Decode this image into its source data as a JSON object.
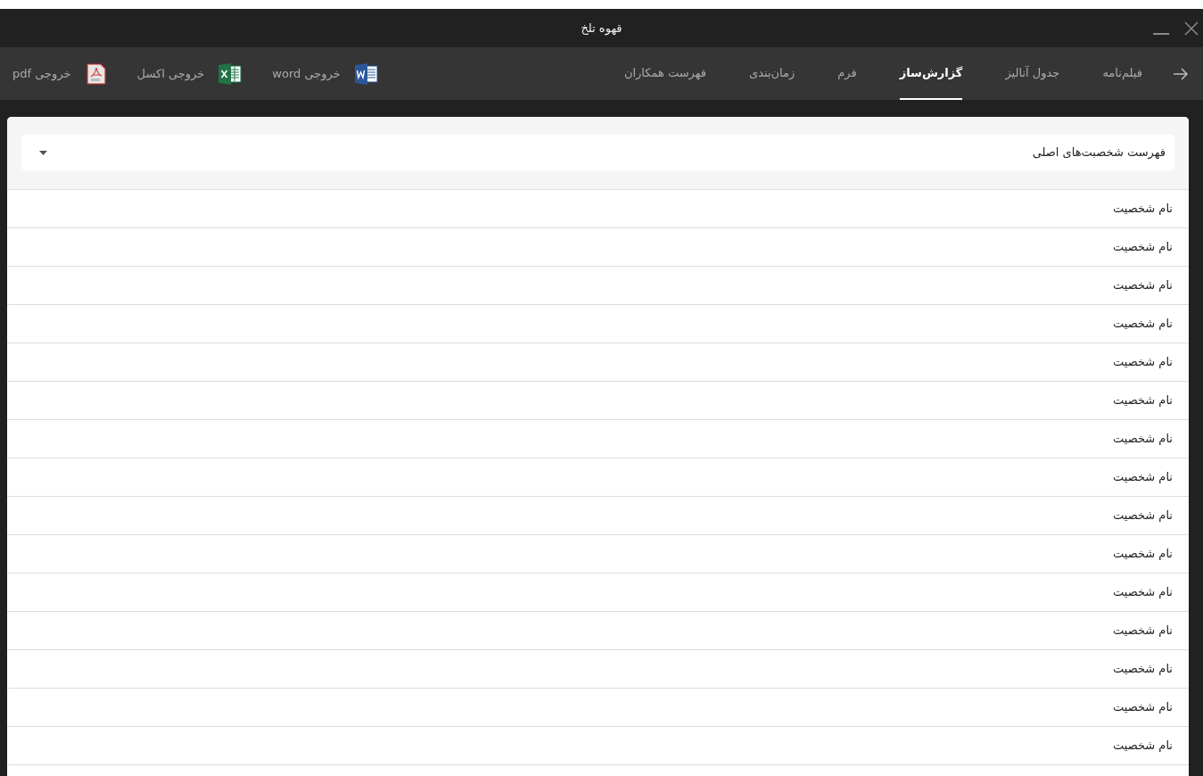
{
  "window": {
    "title": "قهوه تلخ"
  },
  "tabs": [
    {
      "label": "فیلم‌نامه",
      "selected": false
    },
    {
      "label": "جدول آنالیز",
      "selected": false
    },
    {
      "label": "گزارش‌ساز",
      "selected": true
    },
    {
      "label": "فرم",
      "selected": false
    },
    {
      "label": "زمان‌بندی",
      "selected": false
    },
    {
      "label": "فهرست همکاران",
      "selected": false
    }
  ],
  "exports": [
    {
      "kind": "word",
      "label": "خروجی word"
    },
    {
      "kind": "excel",
      "label": "خروجی اکسل"
    },
    {
      "kind": "pdf",
      "label": "خروجی pdf"
    }
  ],
  "dropdown": {
    "value": "فهرست شخصبت‌های اصلی"
  },
  "rows": [
    {
      "name": "نام شخصیت"
    },
    {
      "name": "نام شخصیت"
    },
    {
      "name": "نام شخصیت"
    },
    {
      "name": "نام شخصیت"
    },
    {
      "name": "نام شخصیت"
    },
    {
      "name": "نام شخصیت"
    },
    {
      "name": "نام شخصیت"
    },
    {
      "name": "نام شخصیت"
    },
    {
      "name": "نام شخصیت"
    },
    {
      "name": "نام شخصیت"
    },
    {
      "name": "نام شخصیت"
    },
    {
      "name": "نام شخصیت"
    },
    {
      "name": "نام شخصیت"
    },
    {
      "name": "نام شخصیت"
    },
    {
      "name": "نام شخصیت"
    }
  ]
}
